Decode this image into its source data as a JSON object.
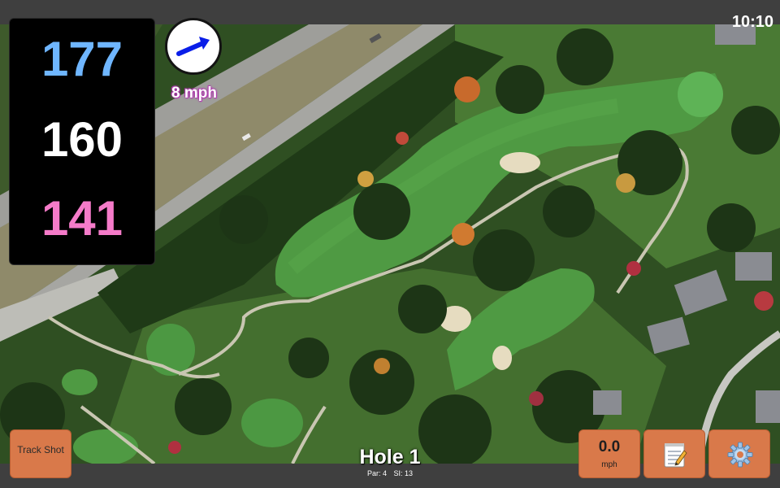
{
  "status_bar": {
    "time": "10:10"
  },
  "distances": {
    "back": "177",
    "middle": "160",
    "front": "141"
  },
  "wind": {
    "speed": "8 mph",
    "arrow_icon": "wind-direction-arrow-icon"
  },
  "hole": {
    "title": "Hole 1",
    "par": "Par: 4",
    "stroke_index": "SI: 13"
  },
  "buttons": {
    "track_shot": "Track Shot",
    "speed_value": "0.0",
    "speed_unit": "mph",
    "notes_icon": "notepad-icon",
    "settings_icon": "gear-icon"
  },
  "colors": {
    "back_distance": "#6fb6ff",
    "middle_distance": "#ffffff",
    "front_distance": "#f57bc9",
    "button_fill": "#d9794a",
    "wind_text_glow": "#c040c0"
  }
}
